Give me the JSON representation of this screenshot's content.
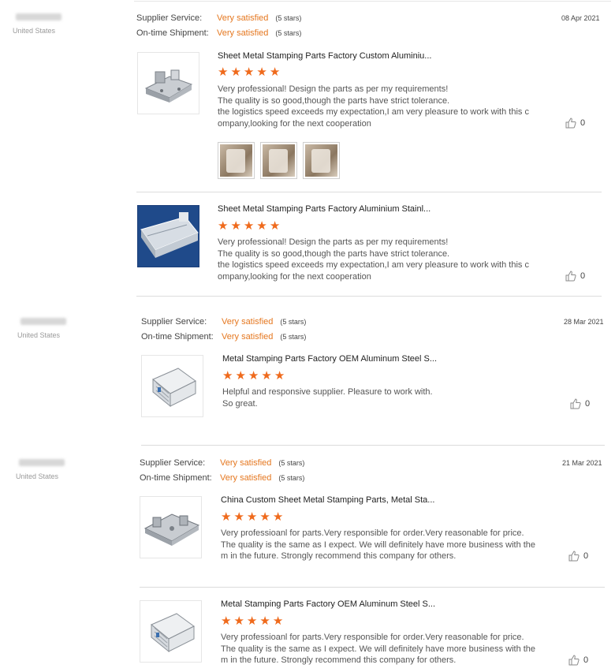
{
  "reviews": [
    {
      "user": {
        "country": "United States"
      },
      "supplier_service": {
        "label": "Supplier Service:",
        "value": "Very satisfied",
        "stars": "(5 stars)"
      },
      "on_time": {
        "label": "On-time Shipment:",
        "value": "Very satisfied",
        "stars": "(5 stars)"
      },
      "date": "08 Apr 2021",
      "items": [
        {
          "title": "Sheet Metal Stamping Parts Factory Custom Aluminiu...",
          "text": "Very professional! Design the parts as per my requirements!\nThe quality is so good,though the parts have strict tolerance.\nthe logistics speed exceeds my expectation,I am very pleasure to work with this c\nompany,looking for the next cooperation",
          "likes": "0"
        },
        {
          "title": "Sheet Metal Stamping Parts Factory Aluminium Stainl...",
          "text": "Very professional! Design the parts as per my requirements!\nThe quality is so good,though the parts have strict tolerance.\nthe logistics speed exceeds my expectation,I am very pleasure to work with this c\nompany,looking for the next cooperation",
          "likes": "0"
        }
      ]
    },
    {
      "user": {
        "country": "United States"
      },
      "supplier_service": {
        "label": "Supplier Service:",
        "value": "Very satisfied",
        "stars": "(5 stars)"
      },
      "on_time": {
        "label": "On-time Shipment:",
        "value": "Very satisfied",
        "stars": "(5 stars)"
      },
      "date": "28 Mar 2021",
      "items": [
        {
          "title": "Metal Stamping Parts Factory OEM Aluminum Steel S...",
          "text": "Helpful and responsive supplier. Pleasure to work with.\nSo great.",
          "likes": "0"
        }
      ]
    },
    {
      "user": {
        "country": "United States"
      },
      "supplier_service": {
        "label": "Supplier Service:",
        "value": "Very satisfied",
        "stars": "(5 stars)"
      },
      "on_time": {
        "label": "On-time Shipment:",
        "value": "Very satisfied",
        "stars": "(5 stars)"
      },
      "date": "21 Mar 2021",
      "items": [
        {
          "title": "China Custom Sheet Metal Stamping Parts, Metal Sta...",
          "text": "Very professioanl for parts.Very responsible for order.Very reasonable for price.\nThe quality is the same as I expect. We will definitely have more business with the\nm in the future. Strongly recommend this company for others.",
          "likes": "0"
        },
        {
          "title": "Metal Stamping Parts Factory OEM Aluminum Steel S...",
          "text": "Very professioanl for parts.Very responsible for order.Very reasonable for price.\nThe quality is the same as I expect. We will definitely have more business with the\nm in the future. Strongly recommend this company for others.",
          "likes": "0"
        }
      ]
    }
  ],
  "rating_stars": 5,
  "colors": {
    "accent": "#e5771f",
    "star": "#ef6a1c"
  },
  "icons": {
    "like": "thumbs-up-icon",
    "star": "star-icon"
  }
}
